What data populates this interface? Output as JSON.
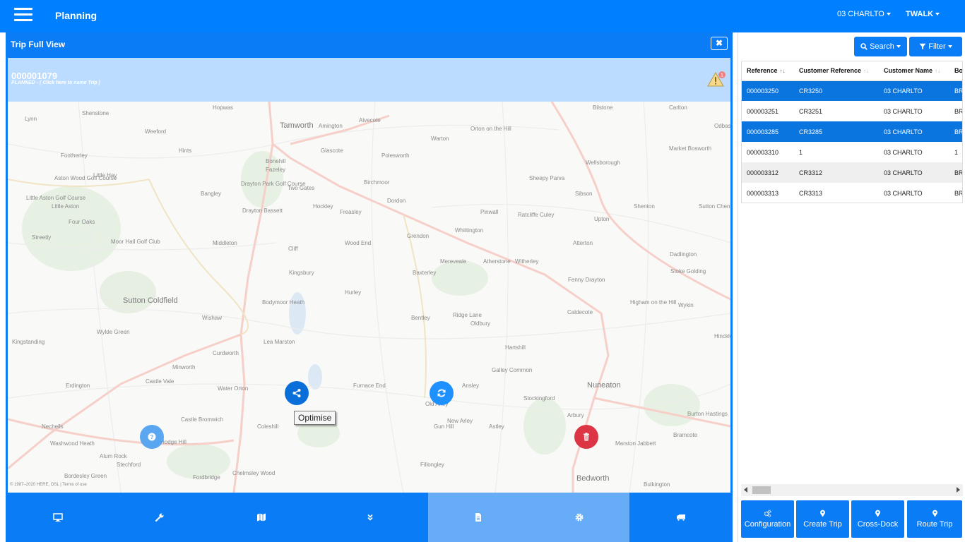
{
  "app": {
    "title": "Planning",
    "depot": "03 CHARLTO",
    "user": "TWALK"
  },
  "trip_panel": {
    "title": "Trip Full View",
    "close_icon": "close-icon",
    "trip_id": "000001079",
    "trip_status": "PLANNED - ( Click here to name Trip )",
    "warning_count": "1"
  },
  "map": {
    "copyright": "© 1987–2020 HERE, OSL | Terms of use",
    "tooltip": "Optimise",
    "places": [
      "Shenstone",
      "Hopwas",
      "Tamworth",
      "Amington",
      "Alvecote",
      "Bilstone",
      "Carlton",
      "Lynn",
      "Weeford",
      "Hints",
      "Glascote",
      "Polesworth",
      "Warton",
      "Orton on the Hill",
      "Odbas",
      "Footherley",
      "Bonehill",
      "Fazeley",
      "Wellsborough",
      "Market Bosworth",
      "Little Hay",
      "Aston Wood Golf Course",
      "Bangley",
      "Two Gates",
      "Birchmoor",
      "Sheepy Parva",
      "Sibson",
      "Little Aston",
      "Drayton Park Golf Course",
      "Dordon",
      "Little Aston Golf Course",
      "Hockley",
      "Freasley",
      "Shenton",
      "Sutton Cheney",
      "Four Oaks",
      "Drayton Bassett",
      "Pinwall",
      "Ratcliffe Culey",
      "Upton",
      "Streetly",
      "Grendon",
      "Whittington",
      "Moor Hall Golf Club",
      "Middleton",
      "Cliff",
      "Wood End",
      "Atterton",
      "Dadlington",
      "Mereveale",
      "Atherstone",
      "Witherley",
      "Kingsbury",
      "Baxterley",
      "Fenny Drayton",
      "Stoke Golding",
      "Sutton Coldfield",
      "Hurley",
      "Higham on the Hill",
      "Wylde Green",
      "Bodymoor Heath",
      "Bentley",
      "Ridge Lane",
      "Caldecote",
      "Wykin",
      "Wishaw",
      "Kingstanding",
      "Lea Marston",
      "Oldbury",
      "Hartshill",
      "Hinckley",
      "Curdworth",
      "Minworth",
      "Galley Common",
      "Castle Vale",
      "Erdington",
      "Water Orton",
      "Furnace End",
      "Ansley",
      "Stockingford",
      "Nuneaton",
      "Coleshill",
      "Old Arley",
      "New Arley",
      "Castle Bromwich",
      "Gun Hill",
      "Astley",
      "Arbury",
      "Burton Hastings",
      "Nechells",
      "Washwood Heath",
      "Hodge Hill",
      "Alum Rock",
      "Stechford",
      "Marston Jabbett",
      "Bramcote",
      "Bordesley Green",
      "Fordbridge",
      "Chelmsley Wood",
      "Fillongley",
      "Bedworth",
      "Bulkington"
    ]
  },
  "toolbar": {
    "buttons": [
      {
        "icon": "desktop-icon"
      },
      {
        "icon": "wrench-icon"
      },
      {
        "icon": "map-icon"
      },
      {
        "icon": "chevron-double-down-icon"
      },
      {
        "icon": "document-icon"
      },
      {
        "icon": "gear-icon"
      },
      {
        "icon": "truck-icon"
      }
    ]
  },
  "right_panel": {
    "search_label": "Search",
    "filter_label": "Filter",
    "columns": [
      "Reference",
      "Customer Reference",
      "Customer Name",
      "Bo"
    ],
    "rows": [
      {
        "reference": "000003250",
        "customer_reference": "CR3250",
        "customer_name": "03 CHARLTO",
        "extra": "BR",
        "selected": true
      },
      {
        "reference": "000003251",
        "customer_reference": "CR3251",
        "customer_name": "03 CHARLTO",
        "extra": "BR",
        "selected": false
      },
      {
        "reference": "000003285",
        "customer_reference": "CR3285",
        "customer_name": "03 CHARLTO",
        "extra": "BR",
        "selected": true
      },
      {
        "reference": "000003310",
        "customer_reference": "1",
        "customer_name": "03 CHARLTO",
        "extra": "1",
        "selected": false
      },
      {
        "reference": "000003312",
        "customer_reference": "CR3312",
        "customer_name": "03 CHARLTO",
        "extra": "BR",
        "selected": false
      },
      {
        "reference": "000003313",
        "customer_reference": "CR3313",
        "customer_name": "03 CHARLTO",
        "extra": "BR",
        "selected": false
      }
    ],
    "actions": [
      {
        "label": "Configuration",
        "icon": "cogs-icon"
      },
      {
        "label": "Create Trip",
        "icon": "map-marker-icon"
      },
      {
        "label": "Cross-Dock",
        "icon": "map-marker-icon"
      },
      {
        "label": "Route Trip",
        "icon": "map-marker-icon"
      }
    ]
  },
  "colors": {
    "primary": "#0080ff",
    "panel": "#0a7cf5",
    "selected_row": "#0a74df",
    "danger": "#dc3545",
    "trip_info_bg": "#bcdcff"
  }
}
